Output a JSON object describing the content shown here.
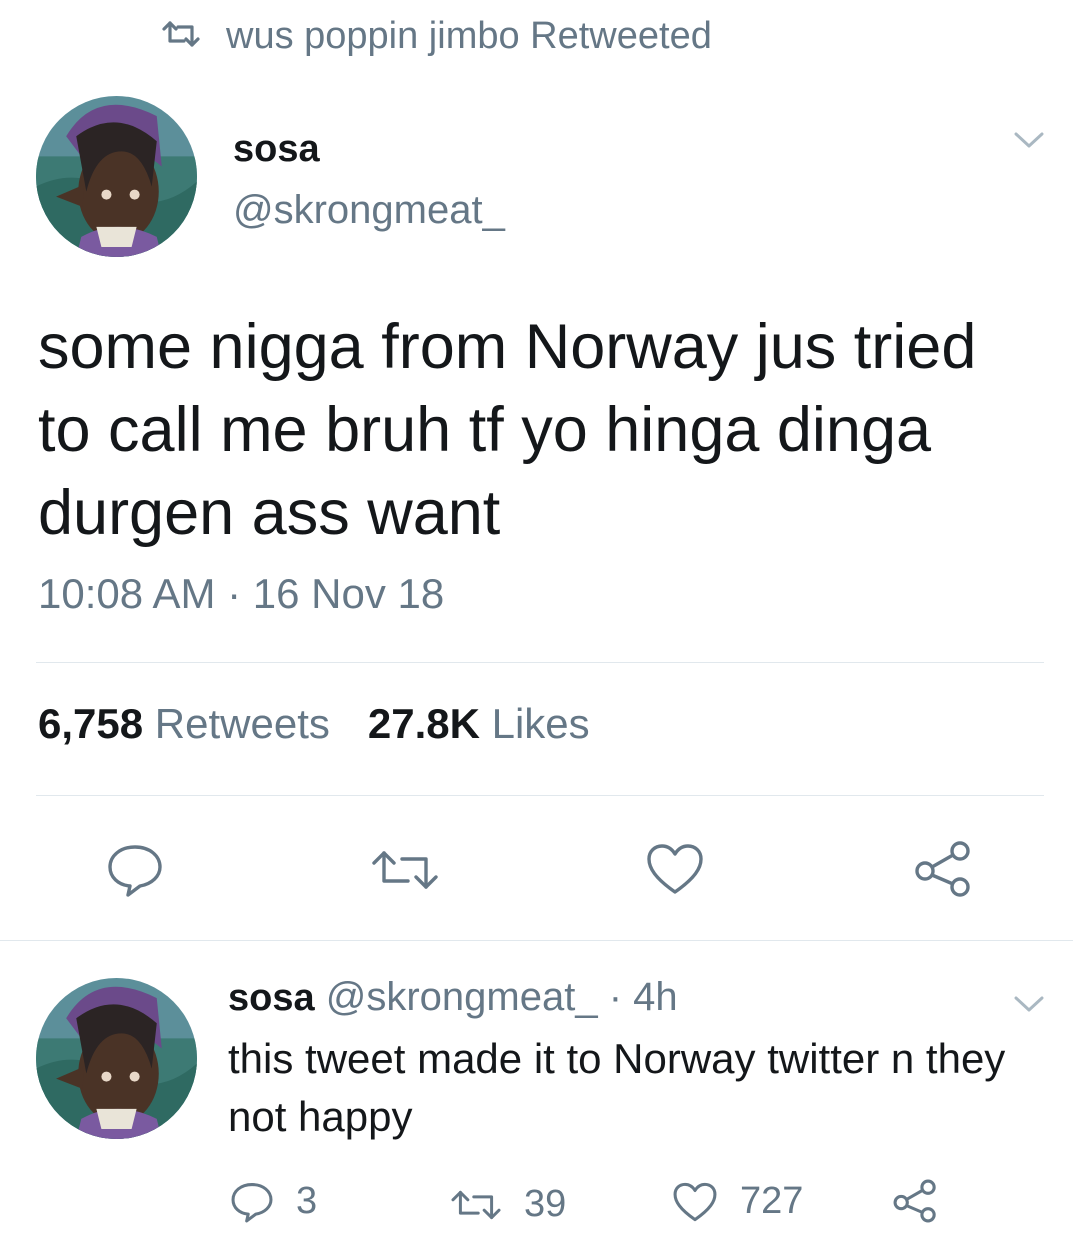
{
  "retweet_banner": {
    "text": "wus poppin jimbo Retweeted"
  },
  "main_tweet": {
    "author_name": "sosa",
    "author_handle": "@skrongmeat_",
    "text": "some nigga from Norway jus tried to call me bruh tf yo hinga dinga durgen ass want",
    "timestamp": "10:08 AM · 16 Nov 18",
    "retweets_count": "6,758",
    "retweets_label": "Retweets",
    "likes_count": "27.8K",
    "likes_label": "Likes"
  },
  "reply_tweet": {
    "author_name": "sosa",
    "author_handle": "@skrongmeat_",
    "age": "· 4h",
    "text": "this tweet made it to Norway twitter n they not happy",
    "reply_count": "3",
    "retweet_count": "39",
    "like_count": "727"
  },
  "colors": {
    "text": "#14171a",
    "muted": "#657786",
    "divider": "#e1e8ed",
    "background": "#ffffff"
  },
  "icons": [
    "retweet-icon",
    "chevron-down-icon",
    "reply-icon",
    "heart-icon",
    "share-icon"
  ]
}
